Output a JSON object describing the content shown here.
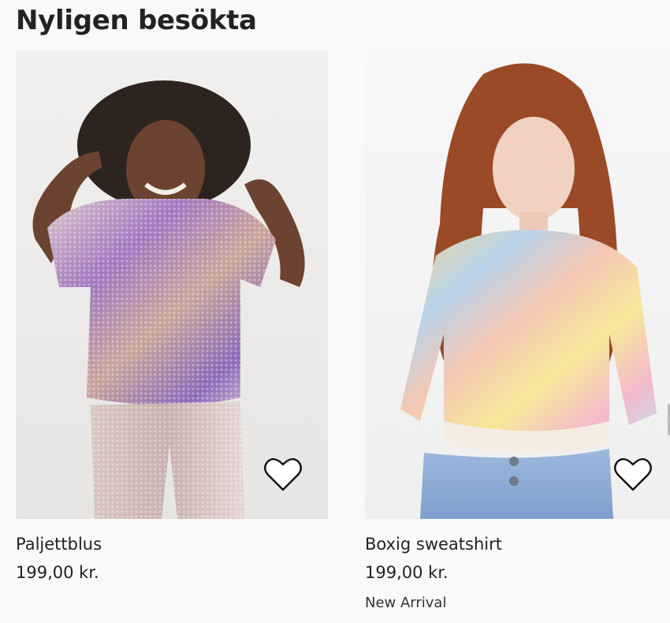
{
  "section": {
    "title": "Nyligen besökta"
  },
  "products": [
    {
      "name": "Paljettblus",
      "price": "199,00 kr.",
      "tag": "",
      "image_icon": "product-photo-sequin-blouse",
      "favorite_icon": "heart-outline-icon"
    },
    {
      "name": "Boxig sweatshirt",
      "price": "199,00 kr.",
      "tag": "New Arrival",
      "image_icon": "product-photo-tie-dye-sweatshirt",
      "favorite_icon": "heart-outline-icon"
    }
  ],
  "colors": {
    "background": "#faf9f8",
    "text": "#222222"
  }
}
